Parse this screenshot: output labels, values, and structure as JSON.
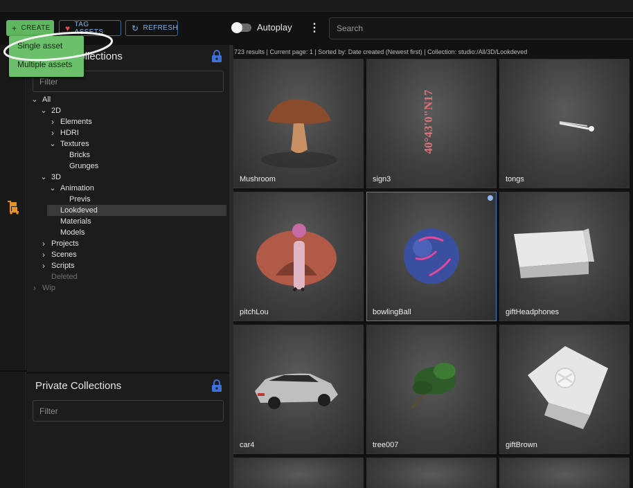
{
  "toolbar": {
    "create_label": "CREATE",
    "tag_label": "TAG ASSETS",
    "refresh_label": "REFRESH",
    "autoplay_label": "Autoplay",
    "search_placeholder": "Search"
  },
  "create_menu": {
    "items": [
      {
        "label": "Single asset"
      },
      {
        "label": "Multiple assets"
      }
    ]
  },
  "shared_collections": {
    "title": "Shared Collections",
    "filter_placeholder": "Filter",
    "tree": [
      {
        "label": "All",
        "depth": 0,
        "expander": "open"
      },
      {
        "label": "2D",
        "depth": 1,
        "expander": "open"
      },
      {
        "label": "Elements",
        "depth": 2,
        "expander": "closed"
      },
      {
        "label": "HDRI",
        "depth": 2,
        "expander": "closed"
      },
      {
        "label": "Textures",
        "depth": 2,
        "expander": "open"
      },
      {
        "label": "Bricks",
        "depth": 3,
        "expander": "none"
      },
      {
        "label": "Grunges",
        "depth": 3,
        "expander": "none"
      },
      {
        "label": "3D",
        "depth": 1,
        "expander": "open"
      },
      {
        "label": "Animation",
        "depth": 2,
        "expander": "open"
      },
      {
        "label": "Previs",
        "depth": 3,
        "expander": "none"
      },
      {
        "label": "Lookdeved",
        "depth": 2,
        "expander": "none",
        "selected": true
      },
      {
        "label": "Materials",
        "depth": 2,
        "expander": "none"
      },
      {
        "label": "Models",
        "depth": 2,
        "expander": "none"
      },
      {
        "label": "Projects",
        "depth": 1,
        "expander": "closed"
      },
      {
        "label": "Scenes",
        "depth": 1,
        "expander": "closed"
      },
      {
        "label": "Scripts",
        "depth": 1,
        "expander": "closed"
      },
      {
        "label": "Deleted",
        "depth": 1,
        "expander": "none",
        "dim": true
      },
      {
        "label": "Wip",
        "depth": 0,
        "expander": "closed",
        "dim": true
      }
    ]
  },
  "private_collections": {
    "title": "Private Collections",
    "filter_placeholder": "Filter"
  },
  "results": {
    "info": "723 results | Current page: 1 | Sorted by: Date created (Newest first) | Collection: studio:/All/3D/Lookdeved",
    "assets": [
      {
        "name": "Mushroom",
        "icon": "mushroom"
      },
      {
        "name": "sign3",
        "icon": "sign-text",
        "sign_text": "40°43'0\"N17"
      },
      {
        "name": "tongs",
        "icon": "tongs"
      },
      {
        "name": "pitchLou",
        "icon": "figure"
      },
      {
        "name": "bowlingBall",
        "icon": "ball",
        "selected": true
      },
      {
        "name": "giftHeadphones",
        "icon": "box"
      },
      {
        "name": "car4",
        "icon": "car"
      },
      {
        "name": "tree007",
        "icon": "tree"
      },
      {
        "name": "giftBrown",
        "icon": "gift"
      }
    ]
  },
  "colors": {
    "accent_green": "#5fb85f",
    "accent_blue": "#3d6a9c",
    "cart_orange": "#e5922d",
    "lock_blue": "#3f6fd8"
  }
}
